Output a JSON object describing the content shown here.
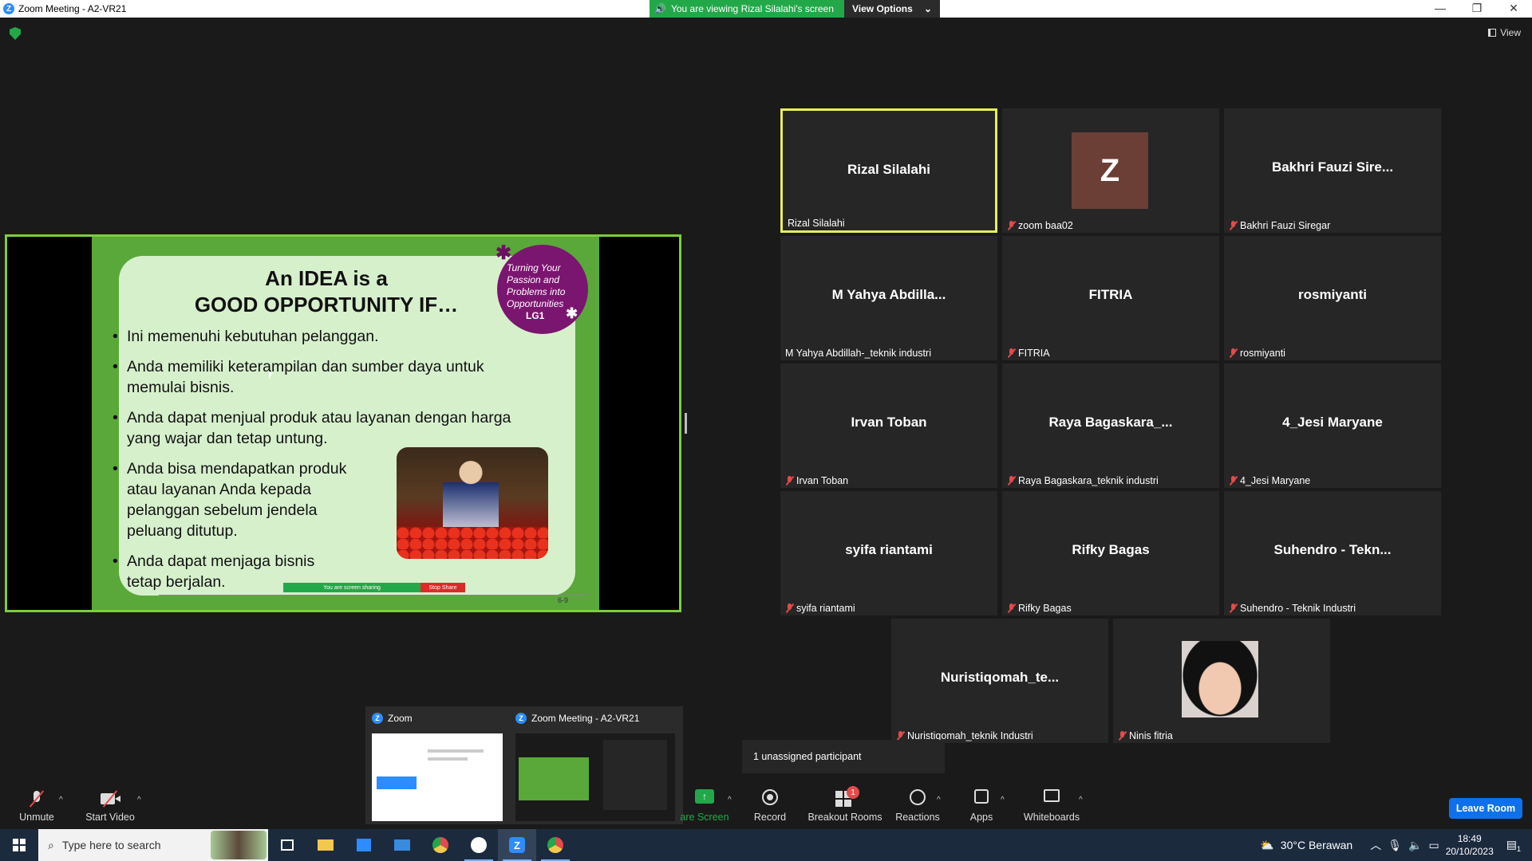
{
  "window": {
    "title": "Zoom Meeting - A2-VR21",
    "controls": [
      "—",
      "❐",
      "✕"
    ]
  },
  "banner": {
    "viewing_text": "You are viewing Rizal Silalahi's screen",
    "view_options_label": "View Options"
  },
  "top_right": {
    "view_label": "View"
  },
  "slide": {
    "title_line1": "An IDEA is a",
    "title_line2": "GOOD OPPORTUNITY IF…",
    "badge_text": "Turning Your Passion and Problems into Opportunities",
    "badge_code": "LG1",
    "bullets": [
      "Ini memenuhi kebutuhan pelanggan.",
      "Anda memiliki keterampilan dan sumber daya untuk memulai bisnis.",
      "Anda dapat menjual produk atau layanan dengan harga yang wajar dan tetap untung.",
      "Anda bisa mendapatkan produk atau layanan Anda kepada pelanggan sebelum jendela peluang ditutup.",
      "Anda dapat menjaga bisnis tetap berjalan."
    ],
    "sharing_bar_text": "You are screen sharing",
    "stop_share_label": "Stop Share",
    "page_number": "6-9"
  },
  "participants": [
    {
      "display": "Rizal Silalahi",
      "label": "Rizal Silalahi",
      "muted": false,
      "active": true
    },
    {
      "display": "Z",
      "label": "zoom baa02",
      "muted": true,
      "avatar": "letter"
    },
    {
      "display": "Bakhri Fauzi Sire...",
      "label": "Bakhri Fauzi Siregar",
      "muted": true
    },
    {
      "display": "M Yahya Abdilla...",
      "label": "M Yahya Abdillah-_teknik industri",
      "muted": false
    },
    {
      "display": "FITRIA",
      "label": "FITRIA",
      "muted": true
    },
    {
      "display": "rosmiyanti",
      "label": "rosmiyanti",
      "muted": true
    },
    {
      "display": "Irvan Toban",
      "label": "Irvan Toban",
      "muted": true
    },
    {
      "display": "Raya Bagaskara_...",
      "label": "Raya Bagaskara_teknik industri",
      "muted": true
    },
    {
      "display": "4_Jesi Maryane",
      "label": "4_Jesi Maryane",
      "muted": true
    },
    {
      "display": "syifa riantami",
      "label": "syifa riantami",
      "muted": true
    },
    {
      "display": "Rifky Bagas",
      "label": "Rifky Bagas",
      "muted": true
    },
    {
      "display": "Suhendro - Tekn...",
      "label": "Suhendro - Teknik Industri",
      "muted": true
    },
    {
      "display": "Nuristiqomah_te...",
      "label": "Nuristiqomah_teknik Industri",
      "muted": true
    },
    {
      "display": "",
      "label": "Ninis fitria",
      "muted": true,
      "avatar": "photo"
    }
  ],
  "task_previews": [
    {
      "title": "Zoom"
    },
    {
      "title": "Zoom Meeting - A2-VR21"
    }
  ],
  "unassigned": "1 unassigned participant",
  "toolbar": {
    "unmute": "Unmute",
    "start_video": "Start Video",
    "share_screen": "are Screen",
    "record": "Record",
    "breakout_rooms": "Breakout Rooms",
    "breakout_badge": "1",
    "reactions": "Reactions",
    "apps": "Apps",
    "whiteboards": "Whiteboards",
    "leave_room": "Leave Room"
  },
  "taskbar": {
    "search_placeholder": "Type here to search",
    "weather": "30°C  Berawan",
    "time": "18:49",
    "date": "20/10/2023",
    "notif_count": "1"
  },
  "colors": {
    "zoom_blue": "#2d8cff",
    "banner_green": "#23a849",
    "active_speaker": "#e6f05a",
    "mute_red": "#e24b4b",
    "leave_blue": "#0e71eb"
  }
}
